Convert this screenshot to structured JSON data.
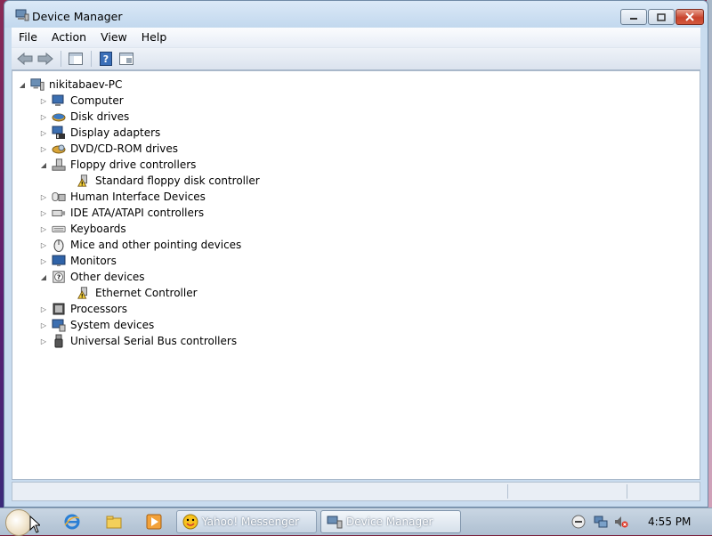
{
  "window": {
    "title": "Device Manager",
    "controls": {
      "minimize": "—",
      "maximize": "▫",
      "close": "✕"
    }
  },
  "menubar": {
    "items": [
      {
        "label": "File"
      },
      {
        "label": "Action"
      },
      {
        "label": "View"
      },
      {
        "label": "Help"
      }
    ]
  },
  "toolbar": {
    "buttons": [
      "back-icon",
      "forward-icon",
      "show-hide-tree-icon",
      "help-icon",
      "properties-icon"
    ]
  },
  "tree": {
    "root": {
      "label": "nikitabaev-PC",
      "icon": "computer-network-icon",
      "expanded": true
    },
    "categories": [
      {
        "label": "Computer",
        "icon": "computer-icon",
        "expanded": false
      },
      {
        "label": "Disk drives",
        "icon": "disk-drive-icon",
        "expanded": false
      },
      {
        "label": "Display adapters",
        "icon": "display-adapter-icon",
        "expanded": false
      },
      {
        "label": "DVD/CD-ROM drives",
        "icon": "dvd-drive-icon",
        "expanded": false
      },
      {
        "label": "Floppy drive controllers",
        "icon": "floppy-controller-icon",
        "expanded": true,
        "children": [
          {
            "label": "Standard floppy disk controller",
            "icon": "warning-device-icon"
          }
        ]
      },
      {
        "label": "Human Interface Devices",
        "icon": "hid-icon",
        "expanded": false
      },
      {
        "label": "IDE ATA/ATAPI controllers",
        "icon": "ide-controller-icon",
        "expanded": false
      },
      {
        "label": "Keyboards",
        "icon": "keyboard-icon",
        "expanded": false
      },
      {
        "label": "Mice and other pointing devices",
        "icon": "mouse-icon",
        "expanded": false
      },
      {
        "label": "Monitors",
        "icon": "monitor-icon",
        "expanded": false
      },
      {
        "label": "Other devices",
        "icon": "unknown-device-icon",
        "expanded": true,
        "children": [
          {
            "label": "Ethernet Controller",
            "icon": "warning-device-icon"
          }
        ]
      },
      {
        "label": "Processors",
        "icon": "processor-icon",
        "expanded": false
      },
      {
        "label": "System devices",
        "icon": "system-devices-icon",
        "expanded": false
      },
      {
        "label": "Universal Serial Bus controllers",
        "icon": "usb-icon",
        "expanded": false
      }
    ]
  },
  "taskbar": {
    "quick_launch": [
      "internet-explorer-icon",
      "windows-explorer-icon",
      "media-player-icon"
    ],
    "tasks": [
      {
        "label": "Yahoo! Messenger",
        "icon": "yahoo-messenger-icon",
        "active": false
      },
      {
        "label": "Device Manager",
        "icon": "device-manager-icon",
        "active": true
      }
    ],
    "tray": [
      "messenger-tray-icon",
      "network-icon",
      "volume-muted-icon"
    ],
    "clock": "4:55 PM"
  }
}
